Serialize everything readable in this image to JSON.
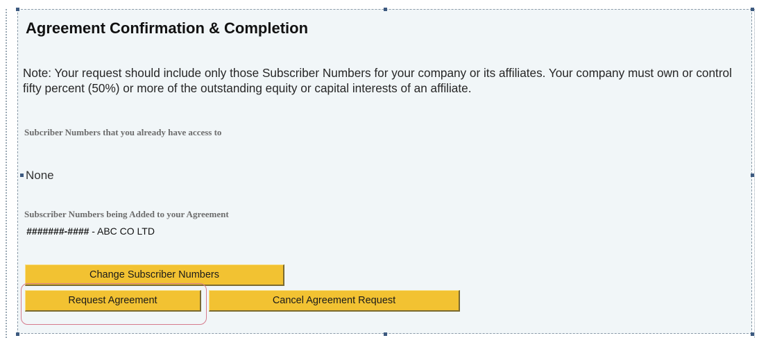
{
  "page": {
    "title": "Agreement Confirmation & Completion",
    "note": "Note: Your request should include only those Subscriber Numbers for your company or its affiliates. Your company must own or control fifty percent (50%) or more of the outstanding equity or capital interests of an affiliate."
  },
  "access": {
    "label": "Subcriber Numbers that you already have access to",
    "value": "None"
  },
  "adding": {
    "label": "Subscriber Numbers being Added to your Agreement",
    "masked_number": "#######-####",
    "company": " - ABC CO LTD"
  },
  "buttons": {
    "change": "Change Subscriber Numbers",
    "request": "Request Agreement",
    "cancel": "Cancel Agreement Request"
  },
  "colors": {
    "button_fill": "#f2c232",
    "highlight": "#d57b8c",
    "panel_bg": "#f1f6f8"
  }
}
